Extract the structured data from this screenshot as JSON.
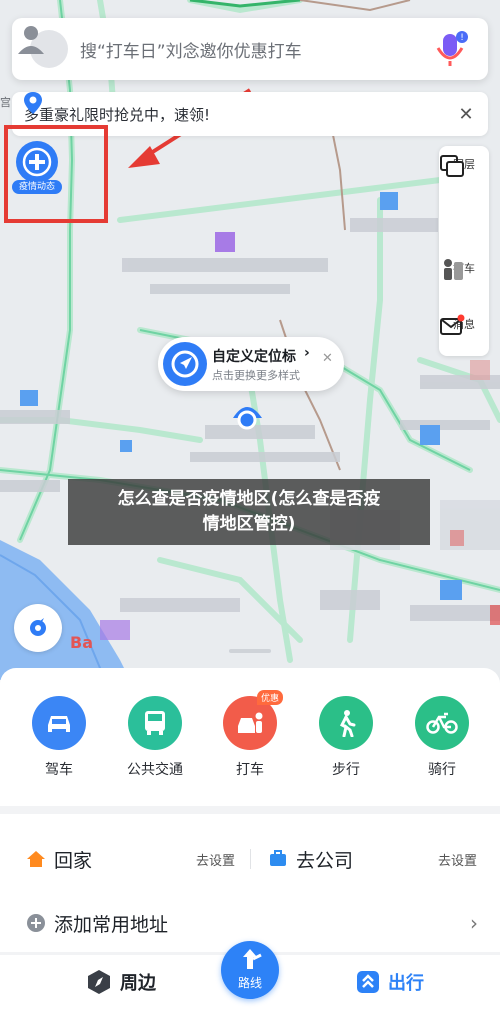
{
  "search": {
    "placeholder": "搜“打车日”刘念邀你优惠打车"
  },
  "promo": {
    "text": "多重豪礼限时抢兑中，速领!"
  },
  "epidemic_button": {
    "label": "疫情动态"
  },
  "right_toolbar": {
    "items": [
      {
        "label": "图层"
      },
      {
        "label": "打车"
      },
      {
        "label": "消息"
      }
    ]
  },
  "location_bubble": {
    "title": "自定义定位标",
    "subtitle": "点击更换更多样式"
  },
  "map_labels": {
    "partial_label": "Ba"
  },
  "overlay": {
    "line1": "怎么查是否疫情地区(怎么查是否疫",
    "line2": "情地区管控)"
  },
  "travel_modes": [
    {
      "label": "驾车",
      "color": "#3b86f5",
      "icon": "car-icon"
    },
    {
      "label": "公共交通",
      "color": "#2bbf9a",
      "icon": "bus-icon"
    },
    {
      "label": "打车",
      "color": "#f25c4a",
      "icon": "taxi-icon",
      "badge": "优惠"
    },
    {
      "label": "步行",
      "color": "#2bbf88",
      "icon": "walk-icon"
    },
    {
      "label": "骑行",
      "color": "#2bbf88",
      "icon": "bike-icon"
    }
  ],
  "places": {
    "home": {
      "label": "回家",
      "action": "去设置",
      "icon_color": "#ff8a1f"
    },
    "company": {
      "label": "去公司",
      "action": "去设置",
      "icon_color": "#2d8cf0"
    },
    "add": {
      "label": "添加常用地址"
    }
  },
  "tabbar": {
    "left": "周边",
    "center": "路线",
    "right": "出行",
    "accent": "#2d82f7"
  }
}
